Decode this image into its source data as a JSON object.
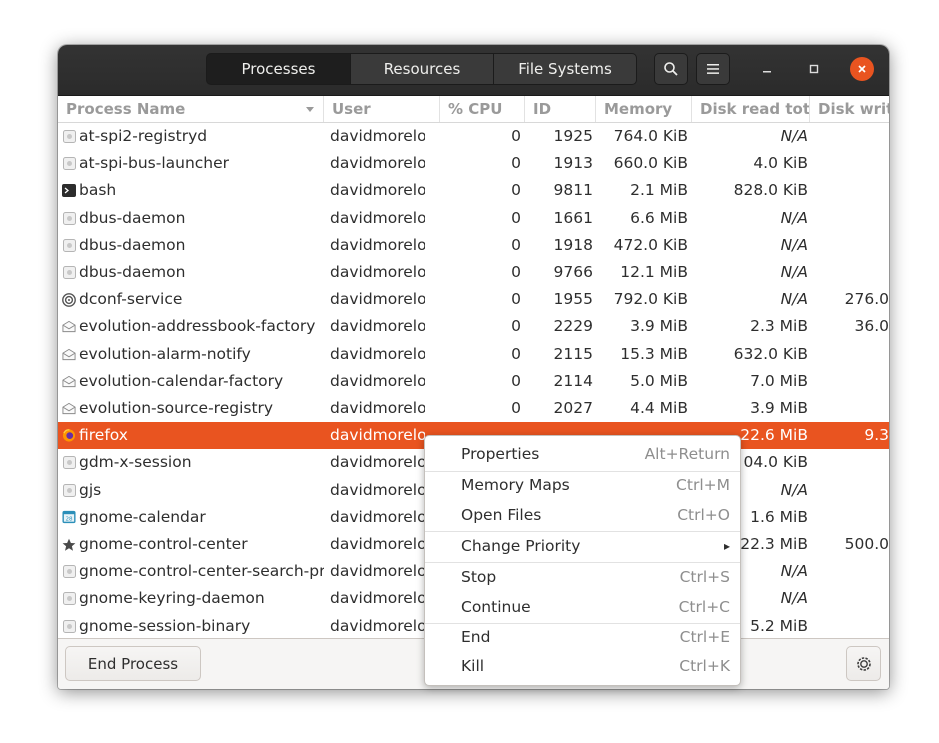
{
  "header": {
    "tabs": [
      "Processes",
      "Resources",
      "File Systems"
    ],
    "active_tab": "Processes",
    "search_icon": "search-icon",
    "menu_icon": "hamburger-menu-icon"
  },
  "columns": {
    "name": "Process Name",
    "user": "User",
    "cpu": "% CPU",
    "id": "ID",
    "memory": "Memory",
    "disk_read": "Disk read total",
    "disk_write": "Disk write"
  },
  "processes": [
    {
      "name": "at-spi2-registryd",
      "user": "davidmorelo",
      "cpu": "0",
      "id": "1925",
      "memory": "764.0 KiB",
      "disk_read": "N/A",
      "disk_write": "",
      "icon": "generic-app-icon"
    },
    {
      "name": "at-spi-bus-launcher",
      "user": "davidmorelo",
      "cpu": "0",
      "id": "1913",
      "memory": "660.0 KiB",
      "disk_read": "4.0 KiB",
      "disk_write": "",
      "icon": "generic-app-icon"
    },
    {
      "name": "bash",
      "user": "davidmorelo",
      "cpu": "0",
      "id": "9811",
      "memory": "2.1 MiB",
      "disk_read": "828.0 KiB",
      "disk_write": "",
      "icon": "terminal-icon"
    },
    {
      "name": "dbus-daemon",
      "user": "davidmorelo",
      "cpu": "0",
      "id": "1661",
      "memory": "6.6 MiB",
      "disk_read": "N/A",
      "disk_write": "",
      "icon": "generic-app-icon"
    },
    {
      "name": "dbus-daemon",
      "user": "davidmorelo",
      "cpu": "0",
      "id": "1918",
      "memory": "472.0 KiB",
      "disk_read": "N/A",
      "disk_write": "",
      "icon": "generic-app-icon"
    },
    {
      "name": "dbus-daemon",
      "user": "davidmorelo",
      "cpu": "0",
      "id": "9766",
      "memory": "12.1 MiB",
      "disk_read": "N/A",
      "disk_write": "",
      "icon": "generic-app-icon"
    },
    {
      "name": "dconf-service",
      "user": "davidmorelo",
      "cpu": "0",
      "id": "1955",
      "memory": "792.0 KiB",
      "disk_read": "N/A",
      "disk_write": "276.0",
      "icon": "dconf-icon"
    },
    {
      "name": "evolution-addressbook-factory",
      "user": "davidmorelo",
      "cpu": "0",
      "id": "2229",
      "memory": "3.9 MiB",
      "disk_read": "2.3 MiB",
      "disk_write": "36.0",
      "icon": "mail-icon"
    },
    {
      "name": "evolution-alarm-notify",
      "user": "davidmorelo",
      "cpu": "0",
      "id": "2115",
      "memory": "15.3 MiB",
      "disk_read": "632.0 KiB",
      "disk_write": "",
      "icon": "mail-icon"
    },
    {
      "name": "evolution-calendar-factory",
      "user": "davidmorelo",
      "cpu": "0",
      "id": "2114",
      "memory": "5.0 MiB",
      "disk_read": "7.0 MiB",
      "disk_write": "",
      "icon": "mail-icon"
    },
    {
      "name": "evolution-source-registry",
      "user": "davidmorelo",
      "cpu": "0",
      "id": "2027",
      "memory": "4.4 MiB",
      "disk_read": "3.9 MiB",
      "disk_write": "",
      "icon": "mail-icon"
    },
    {
      "name": "firefox",
      "user": "davidmorelo",
      "cpu": "",
      "id": "",
      "memory": "",
      "disk_read": "22.6 MiB",
      "disk_write": "9.3",
      "icon": "firefox-icon",
      "selected": true
    },
    {
      "name": "gdm-x-session",
      "user": "davidmorelo",
      "cpu": "",
      "id": "",
      "memory": "",
      "disk_read": "04.0 KiB",
      "disk_write": "",
      "icon": "generic-app-icon"
    },
    {
      "name": "gjs",
      "user": "davidmorelo",
      "cpu": "",
      "id": "",
      "memory": "",
      "disk_read": "N/A",
      "disk_write": "",
      "icon": "generic-app-icon"
    },
    {
      "name": "gnome-calendar",
      "user": "davidmorelo",
      "cpu": "",
      "id": "",
      "memory": "",
      "disk_read": "1.6 MiB",
      "disk_write": "",
      "icon": "calendar-icon"
    },
    {
      "name": "gnome-control-center",
      "user": "davidmorelo",
      "cpu": "",
      "id": "",
      "memory": "",
      "disk_read": "22.3 MiB",
      "disk_write": "500.0",
      "icon": "star-icon"
    },
    {
      "name": "gnome-control-center-search-provider",
      "user": "davidmorelo",
      "cpu": "",
      "id": "",
      "memory": "",
      "disk_read": "N/A",
      "disk_write": "",
      "icon": "generic-app-icon"
    },
    {
      "name": "gnome-keyring-daemon",
      "user": "davidmorelo",
      "cpu": "",
      "id": "",
      "memory": "",
      "disk_read": "N/A",
      "disk_write": "",
      "icon": "generic-app-icon"
    },
    {
      "name": "gnome-session-binary",
      "user": "davidmorelo",
      "cpu": "",
      "id": "",
      "memory": "",
      "disk_read": "5.2 MiB",
      "disk_write": "",
      "icon": "generic-app-icon"
    }
  ],
  "footer": {
    "end_process_label": "End Process",
    "preferences_icon": "gear-icon"
  },
  "context_menu": {
    "items": [
      {
        "label": "Properties",
        "accel": "Alt+Return"
      },
      {
        "label": "Memory Maps",
        "accel": "Ctrl+M"
      },
      {
        "label": "Open Files",
        "accel": "Ctrl+O"
      },
      {
        "label": "Change Priority",
        "accel": "▸"
      },
      {
        "label": "Stop",
        "accel": "Ctrl+S"
      },
      {
        "label": "Continue",
        "accel": "Ctrl+C"
      },
      {
        "label": "End",
        "accel": "Ctrl+E"
      },
      {
        "label": "Kill",
        "accel": "Ctrl+K"
      }
    ]
  },
  "colors": {
    "accent": "#e95420",
    "headerbar": "#2f2f2f"
  }
}
